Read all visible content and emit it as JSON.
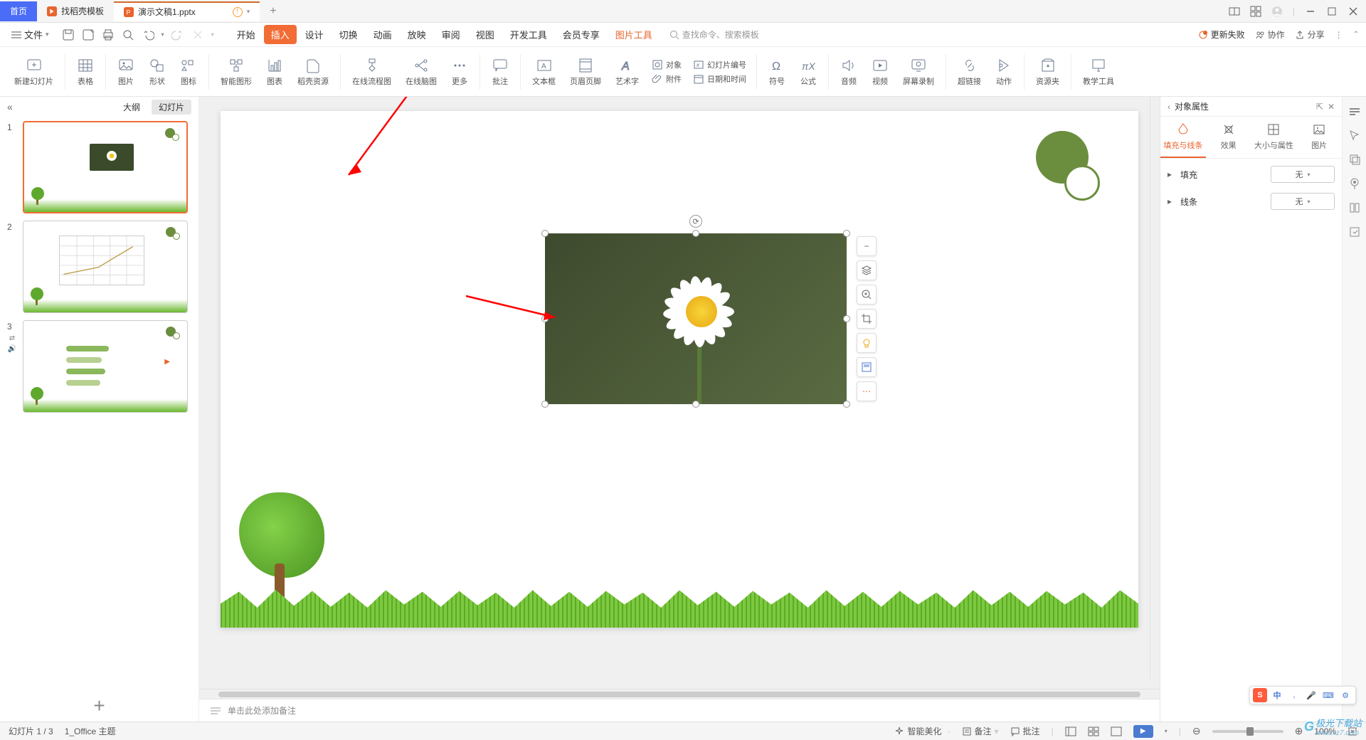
{
  "titlebar": {
    "home": "首页",
    "template_tab": "找稻壳模板",
    "doc_tab": "演示文稿1.pptx",
    "new_tab": "+"
  },
  "menubar": {
    "file": "文件",
    "tabs": [
      "开始",
      "插入",
      "设计",
      "切换",
      "动画",
      "放映",
      "审阅",
      "视图",
      "开发工具",
      "会员专享"
    ],
    "context_tab": "图片工具",
    "active_index": 1,
    "search_placeholder": "查找命令、搜索模板",
    "update_fail": "更新失败",
    "coop": "协作",
    "share": "分享"
  },
  "ribbon": {
    "items": [
      "新建幻灯片",
      "表格",
      "图片",
      "形状",
      "图标",
      "智能图形",
      "图表",
      "稻壳资源",
      "在线流程图",
      "在线脑图",
      "更多",
      "批注",
      "文本框",
      "页眉页脚",
      "艺术字",
      "符号",
      "公式",
      "音频",
      "视频",
      "屏幕录制",
      "超链接",
      "动作",
      "资源夹",
      "教学工具"
    ],
    "sub_items": {
      "object": "对象",
      "slide_num": "幻灯片编号",
      "attachment": "附件",
      "datetime": "日期和时间"
    }
  },
  "slide_panel": {
    "outline": "大纲",
    "slides": "幻灯片",
    "count": 3
  },
  "notes": {
    "placeholder": "单击此处添加备注"
  },
  "right_panel": {
    "title": "对象属性",
    "tabs": [
      "填充与线条",
      "效果",
      "大小与属性",
      "图片"
    ],
    "fill_label": "填充",
    "line_label": "线条",
    "none": "无"
  },
  "statusbar": {
    "slide_pos": "幻灯片 1 / 3",
    "theme": "1_Office 主题",
    "beautify": "智能美化",
    "backup": "备注",
    "annotate": "批注",
    "zoom": "100%"
  },
  "ime": {
    "cn": "中"
  },
  "watermark": {
    "text": "极光下载站",
    "url": "www.xz7.com"
  }
}
